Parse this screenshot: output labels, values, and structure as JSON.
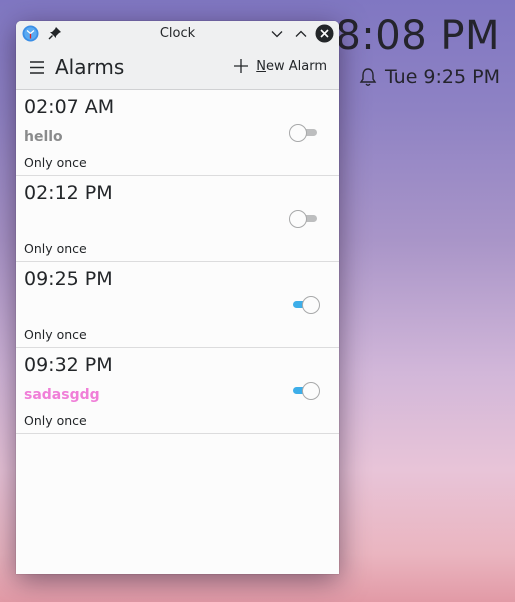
{
  "desktop_clock": {
    "time": "8:08 PM",
    "next_alarm": "Tue 9:25 PM",
    "alarm_icon": "bell-icon"
  },
  "window": {
    "title": "Clock",
    "icons": [
      "clock-app-icon",
      "pin-icon"
    ],
    "buttons": [
      "minimize",
      "maximize",
      "close"
    ]
  },
  "header": {
    "title": "Alarms",
    "menu_icon": "hamburger-icon",
    "new_alarm_mnemonic": "N",
    "new_alarm_rest": "ew Alarm"
  },
  "colors": {
    "accent": "#3daee9",
    "name_muted": "#8a8b8c",
    "name_pink": "#f07fd8"
  },
  "alarms": [
    {
      "time": "02:07 AM",
      "name": "hello",
      "repeat": "Only once",
      "enabled": false
    },
    {
      "time": "02:12 PM",
      "name": "",
      "repeat": "Only once",
      "enabled": false
    },
    {
      "time": "09:25 PM",
      "name": "",
      "repeat": "Only once",
      "enabled": true
    },
    {
      "time": "09:32 PM",
      "name": "sadasgdg",
      "repeat": "Only once",
      "enabled": true
    }
  ]
}
